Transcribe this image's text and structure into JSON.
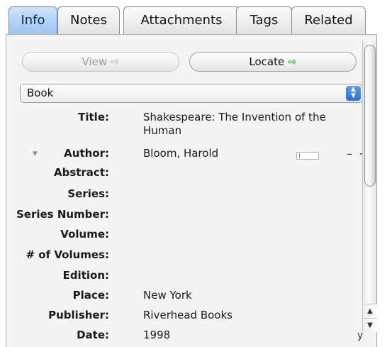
{
  "tabs": [
    {
      "label": "Info",
      "active": true
    },
    {
      "label": "Notes",
      "active": false
    },
    {
      "label": "Attachments",
      "active": false
    },
    {
      "label": "Tags",
      "active": false
    },
    {
      "label": "Related",
      "active": false
    }
  ],
  "buttons": {
    "view_label": "View",
    "view_enabled": false,
    "locate_label": "Locate",
    "arrow_glyph": "⇨"
  },
  "item_type": {
    "selected": "Book",
    "stepper_up": "▲",
    "stepper_down": "▼"
  },
  "fields": {
    "title": {
      "label": "Title:",
      "value_line1": "Shakespeare: The Invention of the",
      "value_line2": "Human"
    },
    "author": {
      "label": "Author:",
      "value": "Bloom,   Harold",
      "twisty": "▼",
      "minus": "–",
      "plus": "+"
    },
    "abstract": {
      "label": "Abstract:",
      "value": ""
    },
    "series": {
      "label": "Series:",
      "value": ""
    },
    "series_number": {
      "label": "Series Number:",
      "value": ""
    },
    "volume": {
      "label": "Volume:",
      "value": ""
    },
    "num_volumes": {
      "label": "# of Volumes:",
      "value": ""
    },
    "edition": {
      "label": "Edition:",
      "value": ""
    },
    "place": {
      "label": "Place:",
      "value": "New York"
    },
    "publisher": {
      "label": "Publisher:",
      "value": "Riverhead Books"
    },
    "date": {
      "label": "Date:",
      "value": "1998",
      "ymd": "y"
    }
  },
  "scrollbar": {
    "up": "▲",
    "down": "▼"
  },
  "colors": {
    "active_tab": "#9ec2ef",
    "panel_bg": "#f4f4f4",
    "stepper_blue": "#2a6fd2",
    "locate_arrow": "#3bb53b"
  }
}
